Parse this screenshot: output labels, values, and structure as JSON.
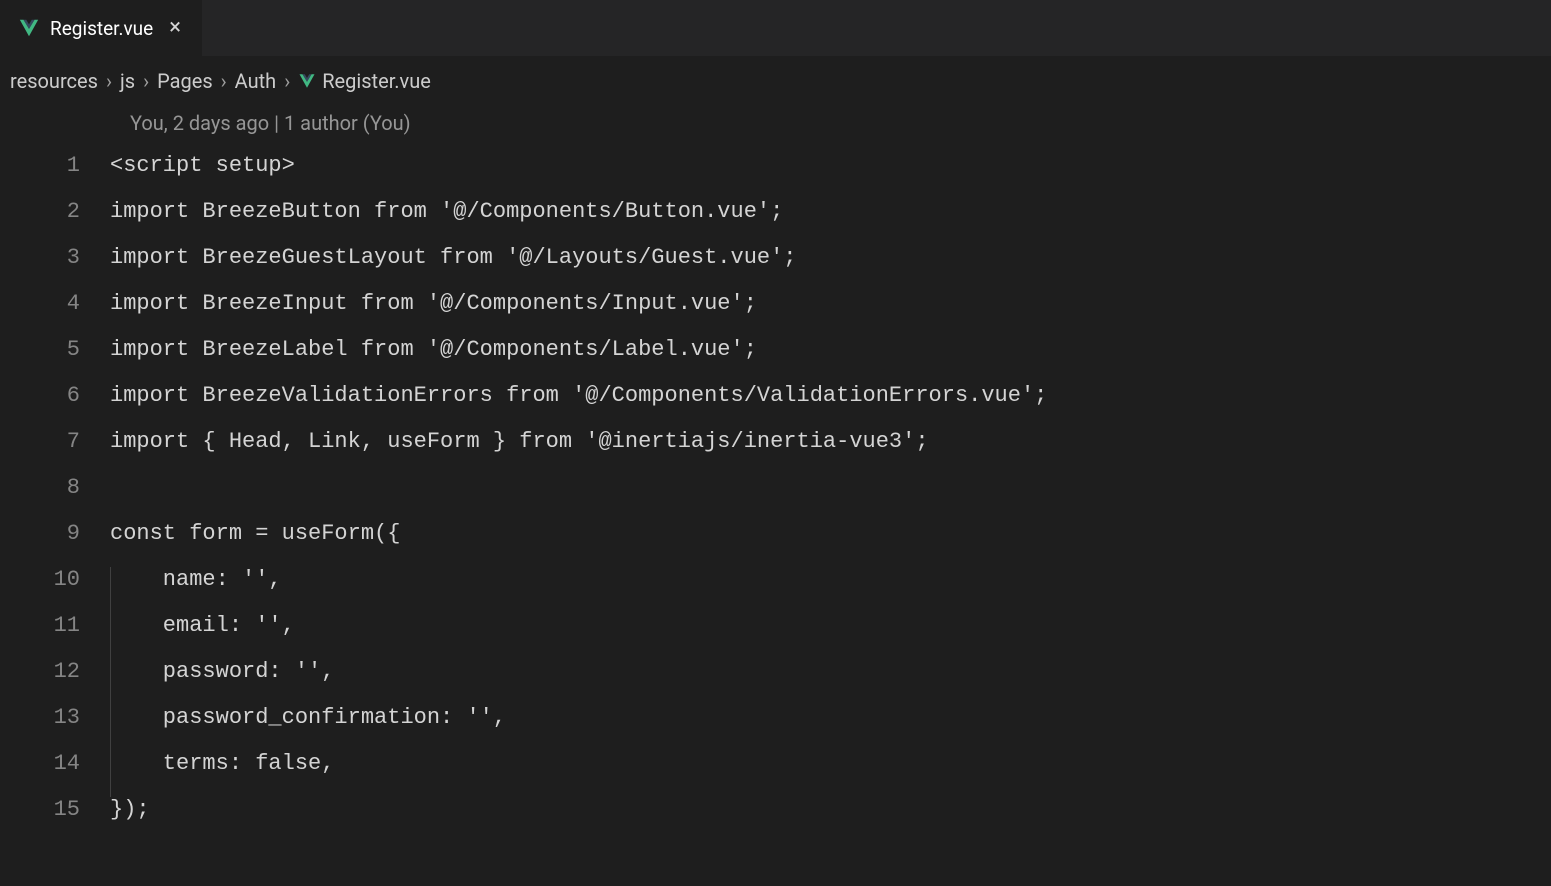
{
  "tab": {
    "label": "Register.vue"
  },
  "breadcrumbs": {
    "parts": [
      "resources",
      "js",
      "Pages",
      "Auth"
    ],
    "file": "Register.vue",
    "sep": "›"
  },
  "codelens": "You, 2 days ago | 1 author (You)",
  "code": {
    "lines": [
      {
        "n": "1",
        "text": "<script setup>",
        "guides": 0
      },
      {
        "n": "2",
        "text": "import BreezeButton from '@/Components/Button.vue';",
        "guides": 0
      },
      {
        "n": "3",
        "text": "import BreezeGuestLayout from '@/Layouts/Guest.vue';",
        "guides": 0
      },
      {
        "n": "4",
        "text": "import BreezeInput from '@/Components/Input.vue';",
        "guides": 0
      },
      {
        "n": "5",
        "text": "import BreezeLabel from '@/Components/Label.vue';",
        "guides": 0
      },
      {
        "n": "6",
        "text": "import BreezeValidationErrors from '@/Components/ValidationErrors.vue';",
        "guides": 0
      },
      {
        "n": "7",
        "text": "import { Head, Link, useForm } from '@inertiajs/inertia-vue3';",
        "guides": 0
      },
      {
        "n": "8",
        "text": "",
        "guides": 0
      },
      {
        "n": "9",
        "text": "const form = useForm({",
        "guides": 0
      },
      {
        "n": "10",
        "text": "    name: '',",
        "guides": 1
      },
      {
        "n": "11",
        "text": "    email: '',",
        "guides": 1
      },
      {
        "n": "12",
        "text": "    password: '',",
        "guides": 1
      },
      {
        "n": "13",
        "text": "    password_confirmation: '',",
        "guides": 1
      },
      {
        "n": "14",
        "text": "    terms: false,",
        "guides": 1
      },
      {
        "n": "15",
        "text": "});",
        "guides": 0
      }
    ]
  }
}
